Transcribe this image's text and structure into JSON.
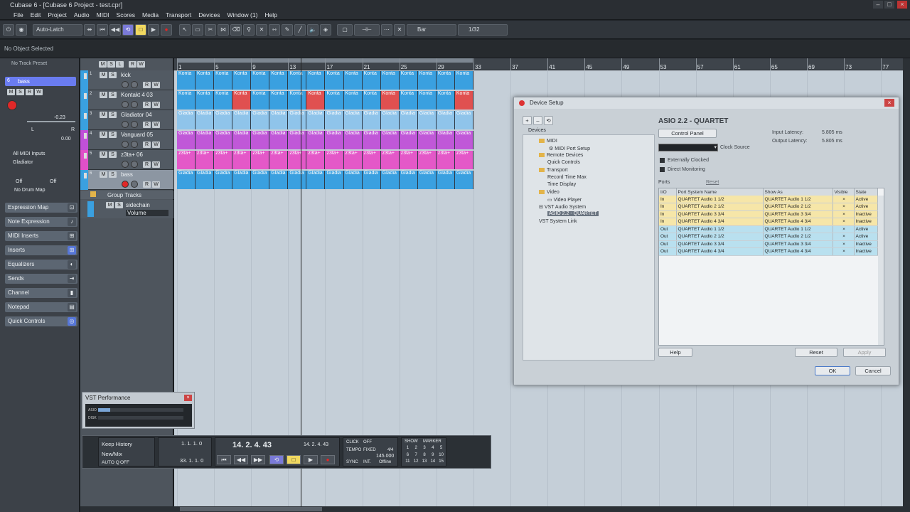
{
  "window": {
    "title": "Cubase 6 - [Cubase 6 Project - test.cpr]",
    "controls": [
      "–",
      "□",
      "×"
    ]
  },
  "menu": [
    "File",
    "Edit",
    "Project",
    "Audio",
    "MIDI",
    "Scores",
    "Media",
    "Transport",
    "Devices",
    "Window (1)",
    "Help"
  ],
  "toolbar": {
    "automation_mode": "Auto-Latch",
    "snap_type": "Bar",
    "quantize": "1/32"
  },
  "infoline": "No Object Selected",
  "inspector": {
    "preset": "No Track Preset",
    "track_name": "bass",
    "track_num": "6",
    "volume": "-0.23",
    "pan": "0.00",
    "pan_left": "L",
    "pan_right": "R",
    "input": "All MIDI Inputs",
    "output": "Gladiator",
    "channel_a": "Off",
    "channel_b": "Off",
    "drum_map": "No Drum Map",
    "sections": [
      "Expression Map",
      "Note Expression",
      "MIDI Inserts",
      "Inserts",
      "Equalizers",
      "Sends",
      "Channel",
      "Notepad",
      "Quick Controls"
    ]
  },
  "tracklist_header": [
    "M",
    "S",
    "L",
    "R",
    "W"
  ],
  "tracks": [
    {
      "num": "1",
      "name": "kick",
      "color": "#3aa0e0"
    },
    {
      "num": "2",
      "name": "Kontakt 4 03",
      "color": "#3aa0e0"
    },
    {
      "num": "3",
      "name": "Gladiator 04",
      "color": "#3aa0e0"
    },
    {
      "num": "4",
      "name": "Vanguard 05",
      "color": "#c050d8"
    },
    {
      "num": "5",
      "name": "z3ta+ 06",
      "color": "#e050c8"
    },
    {
      "num": "6",
      "name": "bass",
      "color": "#3aa0e0"
    }
  ],
  "group_tracks": {
    "label": "Group Tracks",
    "track": "sidechain",
    "param": "Volume"
  },
  "ruler_labels": [
    "1",
    "5",
    "9",
    "13",
    "17",
    "21",
    "25",
    "29",
    "33",
    "37",
    "41",
    "45",
    "49",
    "53",
    "57",
    "61",
    "65",
    "69",
    "73",
    "77"
  ],
  "parts": {
    "kick": "Konta",
    "kontakt": "Konta",
    "gladiator": "Gladia",
    "vanguard": "Gladia",
    "z3ta": "z3ta+",
    "bass": "Gladia"
  },
  "device_setup": {
    "title": "Device Setup",
    "tree_header": "Devices",
    "tree_toolbar": [
      "+",
      "–",
      "⟲"
    ],
    "tree": [
      "MIDI",
      "MIDI Port Setup",
      "Remote Devices",
      "Quick Controls",
      "Transport",
      "Record Time Max",
      "Time Display",
      "Video",
      "Video Player",
      "VST Audio System",
      "ASIO 2.2 - QUARTET",
      "VST System Link"
    ],
    "panel_title": "ASIO 2.2 - QUARTET",
    "control_panel": "Control Panel",
    "input_latency_label": "Input Latency:",
    "input_latency": "5.805 ms",
    "output_latency_label": "Output Latency:",
    "output_latency": "5.805 ms",
    "clock_source": "Clock Source",
    "externally_clocked": "Externally Clocked",
    "direct_monitoring": "Direct Monitoring",
    "ports_label": "Ports",
    "reset_link": "Reset",
    "columns": [
      "I/O",
      "Port System Name",
      "Show As",
      "Visible",
      "State"
    ],
    "rows": [
      {
        "io": "In",
        "name": "QUARTET Audio 1 1/2",
        "show": "QUARTET Audio 1 1/2",
        "visible": "×",
        "state": "Active"
      },
      {
        "io": "In",
        "name": "QUARTET Audio 2 1/2",
        "show": "QUARTET Audio 2 1/2",
        "visible": "×",
        "state": "Active"
      },
      {
        "io": "In",
        "name": "QUARTET Audio 3 3/4",
        "show": "QUARTET Audio 3 3/4",
        "visible": "×",
        "state": "Inactive"
      },
      {
        "io": "In",
        "name": "QUARTET Audio 4 3/4",
        "show": "QUARTET Audio 4 3/4",
        "visible": "×",
        "state": "Inactive"
      },
      {
        "io": "Out",
        "name": "QUARTET Audio 1 1/2",
        "show": "QUARTET Audio 1 1/2",
        "visible": "×",
        "state": "Active"
      },
      {
        "io": "Out",
        "name": "QUARTET Audio 2 1/2",
        "show": "QUARTET Audio 2 1/2",
        "visible": "×",
        "state": "Active"
      },
      {
        "io": "Out",
        "name": "QUARTET Audio 3 3/4",
        "show": "QUARTET Audio 3 3/4",
        "visible": "×",
        "state": "Inactive"
      },
      {
        "io": "Out",
        "name": "QUARTET Audio 4 3/4",
        "show": "QUARTET Audio 4 3/4",
        "visible": "×",
        "state": "Inactive"
      }
    ],
    "help": "Help",
    "reset": "Reset",
    "apply": "Apply",
    "ok": "OK",
    "cancel": "Cancel"
  },
  "vst_performance": {
    "title": "VST Performance",
    "asio": "ASIO",
    "disk": "DISK"
  },
  "transport": {
    "keep_history": "Keep History",
    "new_mix": "New/Mix",
    "auto_q": "AUTO Q",
    "auto_q_state": "OFF",
    "left_loc": "1. 1. 1.   0",
    "right_loc": "33. 1. 1.   0",
    "pos_main": "14. 2. 4. 43",
    "pos_sub": "14. 2. 4. 43",
    "loc_l": "1. 1. 1.   0",
    "loc_r": "0",
    "click": "CLICK",
    "click_state": "OFF",
    "tempo": "TEMPO",
    "tempo_mode": "FIXED",
    "sig": "4/4",
    "bpm": "145.000",
    "sync": "SYNC",
    "sync_src": "INT.",
    "sync_state": "Offline",
    "show": "SHOW",
    "marker": "MARKER",
    "markers": [
      "1",
      "2",
      "3",
      "4",
      "5",
      "6",
      "7",
      "8",
      "9",
      "10",
      "11",
      "12",
      "13",
      "14",
      "15"
    ]
  }
}
